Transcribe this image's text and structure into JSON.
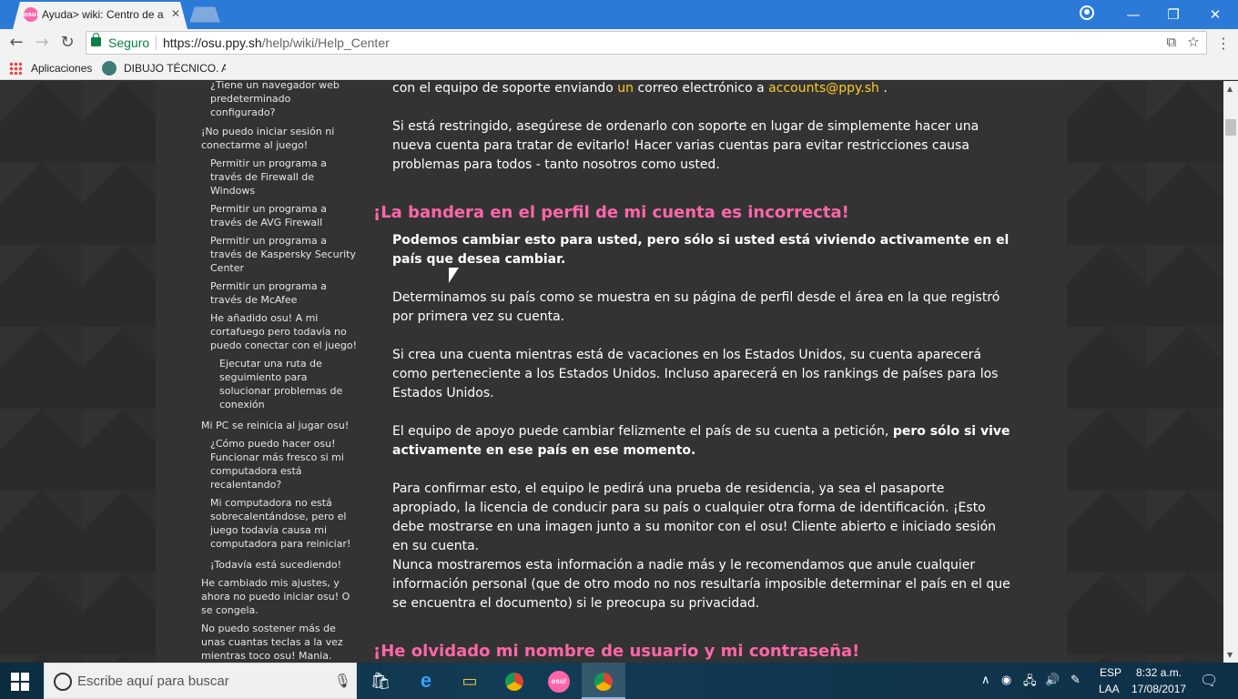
{
  "browser": {
    "tab_title": "Ayuda> wiki: Centro de a",
    "tab_favicon_text": "osu!",
    "secure_label": "Seguro",
    "url_scheme_host": "https://osu.ppy.sh",
    "url_path": "/help/wiki/Help_Center",
    "bookmarks": [
      "Aplicaciones",
      "DIBUJO TÉCNICO. AC"
    ]
  },
  "sidebar": {
    "items": [
      "¿Tiene un navegador web predeterminado configurado?",
      "¡No puedo iniciar sesión ni conectarme al juego!",
      "Permitir un programa a través de Firewall de Windows",
      "Permitir un programa a través de AVG Firewall",
      "Permitir un programa a través de Kaspersky Security Center",
      "Permitir un programa a través de McAfee",
      "He añadido osu! A mi cortafuego pero todavía no puedo conectar con el juego!",
      "Ejecutar una ruta de seguimiento para solucionar problemas de conexión",
      "Mi PC se reinicia al jugar osu!",
      "¿Cómo puedo hacer osu! Funcionar más fresco si mi computadora está recalentando?",
      "Mi computadora no está sobrecalentándose, pero el juego todavía causa mi computadora para reiniciar!",
      "¡Todavía está sucediendo!",
      "He cambiado mis ajustes, y ahora no puedo iniciar osu! O se congela.",
      "No puedo sostener más de unas cuantas teclas a la vez mientras toco osu! Mania."
    ]
  },
  "content": {
    "p0_a": "con el equipo de soporte enviando ",
    "p0_un": "un",
    "p0_b": " correo electrónico a ",
    "p0_email": "accounts@ppy.sh",
    "p0_c": " .",
    "p1": "Si está restringido, asegúrese de ordenarlo con soporte en lugar de simplemente hacer una nueva cuenta para tratar de evitarlo! Hacer varias cuentas para evitar restricciones causa problemas para todos - tanto nosotros como usted.",
    "h_flag": "¡La bandera en el perfil de mi cuenta es incorrecta!",
    "p2": "Podemos cambiar esto para usted, pero sólo si usted está viviendo activamente en el país que desea cambiar.",
    "p3": "Determinamos su país como se muestra en su página de perfil desde el área en la que registró por primera vez su cuenta.",
    "p4": "Si crea una cuenta mientras está de vacaciones en los Estados Unidos, su cuenta aparecerá como perteneciente a los Estados Unidos. Incluso aparecerá en los rankings de países para los Estados Unidos.",
    "p5_a": "El equipo de apoyo puede cambiar felizmente el país de su cuenta a petición, ",
    "p5_b": "pero sólo si vive activamente en ese país en ese momento.",
    "p6": "Para confirmar esto, el equipo le pedirá una prueba de residencia, ya sea el pasaporte apropiado, la licencia de conducir para su país o cualquier otra forma de identificación. ¡Esto debe mostrarse en una imagen junto a su monitor con el osu! Cliente abierto e iniciado sesión en su cuenta.",
    "p7": "Nunca mostraremos esta información a nadie más y le recomendamos que anule cualquier información personal (que de otro modo no nos resultaría imposible determinar el país en el que se encuentra el documento) si le preocupa su privacidad.",
    "h_forgot": "¡He olvidado mi nombre de usuario y mi contraseña!"
  },
  "taskbar": {
    "search_placeholder": "Escribe aquí para buscar",
    "lang_top": "ESP",
    "lang_bottom": "LAA",
    "time": "8:32 a.m.",
    "date": "17/08/2017",
    "osu_label": "osu!"
  },
  "colors": {
    "heading": "#ff66aa",
    "link": "#ffcc22",
    "titlebar": "#2b7ad8"
  }
}
